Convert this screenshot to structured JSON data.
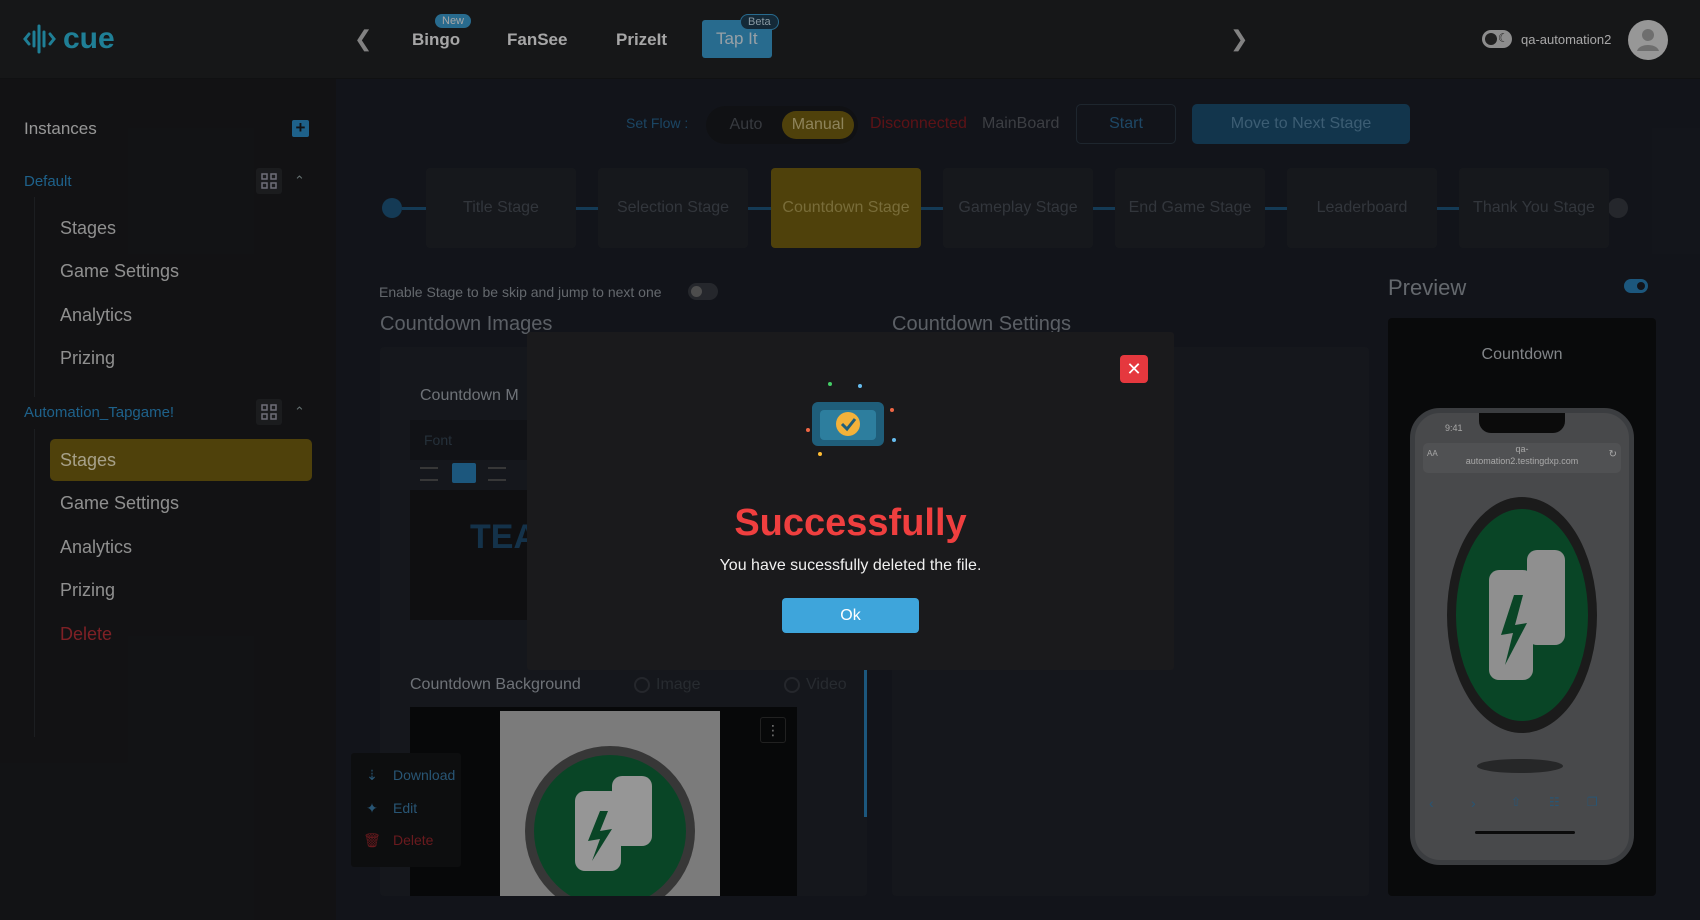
{
  "app": {
    "brand": "cue"
  },
  "topnav": {
    "tabs": [
      {
        "label": "Bingo",
        "badge": "New"
      },
      {
        "label": "FanSee"
      },
      {
        "label": "PrizeIt"
      },
      {
        "label": "Tap It",
        "badge": "Beta",
        "active": true
      }
    ],
    "user": "qa-automation2"
  },
  "sidebar": {
    "heading": "Instances",
    "instances": [
      {
        "name": "Default",
        "items": [
          "Stages",
          "Game Settings",
          "Analytics",
          "Prizing"
        ]
      },
      {
        "name": "Automation_Tapgame!",
        "items": [
          "Stages",
          "Game Settings",
          "Analytics",
          "Prizing",
          "Delete"
        ],
        "active_item": "Stages"
      }
    ]
  },
  "toolbar": {
    "set_flow_label": "Set Flow :",
    "flow_options": [
      "Auto",
      "Manual"
    ],
    "flow_selected": "Manual",
    "status_error": "Disconnected",
    "status_board": "MainBoard",
    "start_label": "Start",
    "next_stage_label": "Move to Next Stage"
  },
  "stages": [
    "Title Stage",
    "Selection Stage",
    "Countdown Stage",
    "Gameplay Stage",
    "End Game Stage",
    "Leaderboard",
    "Thank You Stage"
  ],
  "active_stage": "Countdown Stage",
  "content": {
    "skip_label": "Enable Stage to be skip and jump to next one",
    "images_title": "Countdown Images",
    "settings_title": "Countdown Settings",
    "message_label": "Countdown M",
    "font_placeholder": "Font",
    "team_text": "TEA",
    "background_label": "Countdown Background",
    "bg_options": [
      "Image",
      "Video"
    ],
    "context_menu": [
      "Download",
      "Edit",
      "Delete"
    ]
  },
  "preview": {
    "title": "Preview",
    "screen_title": "Countdown",
    "phone_time": "9:41",
    "phone_url_1": "qa-",
    "phone_url_2": "automation2.testingdxp.com",
    "url_prefix": "AA"
  },
  "modal": {
    "title": "Successfully",
    "message": "You have sucessfully deleted the file.",
    "ok_label": "Ok"
  },
  "colors": {
    "accent": "#3ea5db",
    "gold": "#7a6411",
    "danger": "#e5383e"
  }
}
